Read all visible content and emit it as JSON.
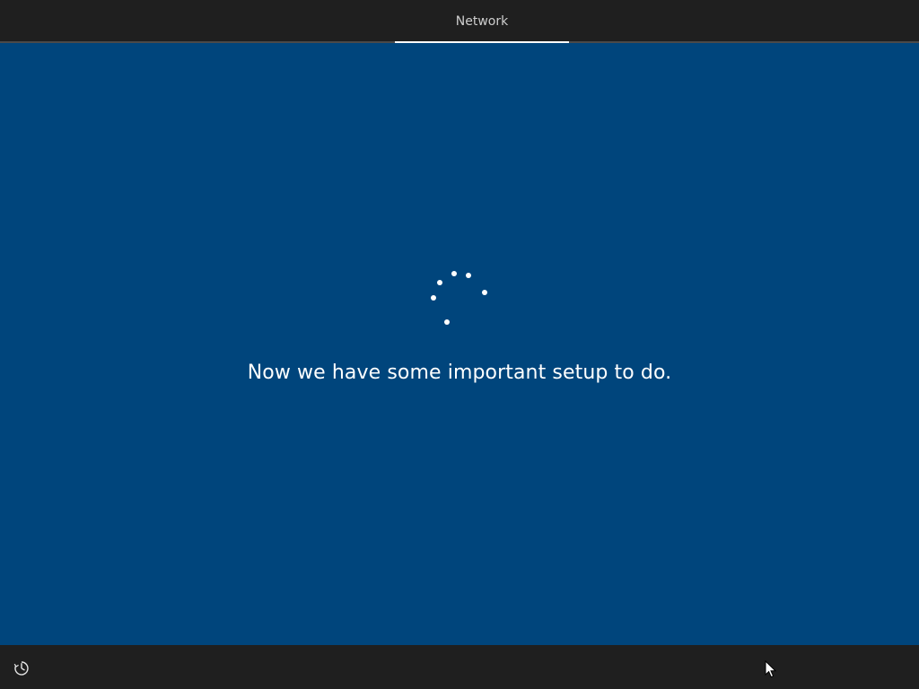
{
  "header": {
    "tab_label": "Network"
  },
  "main": {
    "message": "Now we have some important setup to do."
  },
  "footer": {
    "ease_of_access_icon": "ease-of-access-icon"
  },
  "colors": {
    "background": "#00457c",
    "bar": "#1f1f1f",
    "text": "#ffffff"
  }
}
